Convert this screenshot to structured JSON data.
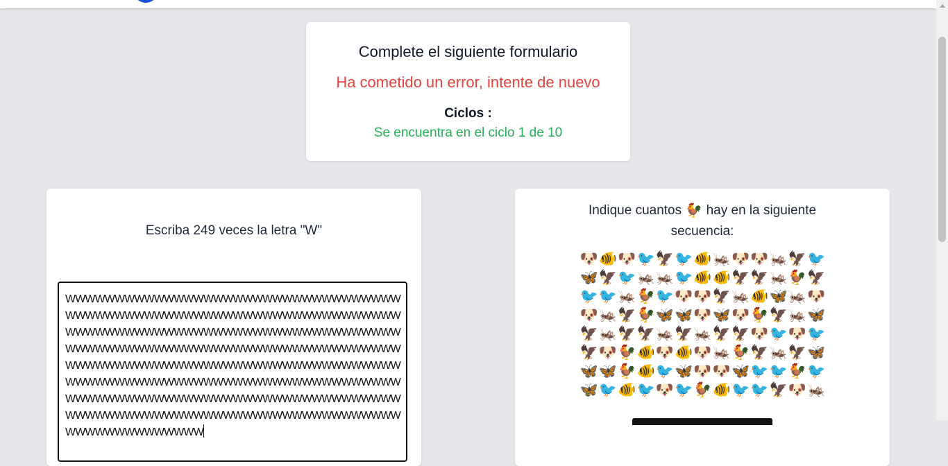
{
  "header": {
    "title": "Complete el siguiente formulario",
    "error_message": "Ha cometido un error, intente de nuevo",
    "cycles_label": "Ciclos :",
    "cycles_status": "Se encuentra en el ciclo 1 de 10",
    "colors": {
      "error": "#e3433c",
      "success": "#22b057"
    }
  },
  "left_task": {
    "instruction": "Escriba 249 veces la letra \"W\"",
    "answer_value": "WWWWWWWWWWWWWWWWWWWWWWWWWWWWWWWWWWWWWWWWWWWWWWWWWWWWWWWWWWWWWWWWWWWWWWWWWWWWWWWWWWWWWWWWWWWWWWWWWWWWWWWWWWWWWWWWWWWWWWWWWWWWWWWWWWWWWWWWWWWWWWWWWWWWWWWWWWWWWWWWWWWWWWWWWWWWWWWWWWWWWWWWWWWWWWWWWWWWWWWWWWWWWWWWWWWWWWWWWWWWWWWWWWWWWWWWWWWWWWWWWWWWWWWWWWWWWWWWWWWWWWWWWWWWWWWWWWWWWWWWWWWWWW"
  },
  "right_task": {
    "question_prefix": "Indique cuantos",
    "target_emoji": "🐓",
    "question_suffix": "hay en la siguiente secuencia:",
    "sequence_rows": [
      [
        "🐶",
        "🐠",
        "🐶",
        "🐦",
        "🦅",
        "🐦",
        "🐠",
        "🦗",
        "🐶",
        "🐶",
        "🦗",
        "🦅",
        "🐦"
      ],
      [
        "🦋",
        "🦅",
        "🐦",
        "🦗",
        "🦗",
        "🐦",
        "🐠",
        "🐠",
        "🦅",
        "🦅",
        "🦗",
        "🐓",
        "🦅"
      ],
      [
        "🐦",
        "🐦",
        "🦗",
        "🐓",
        "🐦",
        "🐶",
        "🐶",
        "🦅",
        "🦗",
        "🐠",
        "🦋",
        "🦗",
        "🐶"
      ],
      [
        "🐶",
        "🦗",
        "🦅",
        "🐓",
        "🦋",
        "🦋",
        "🐶",
        "🦋",
        "🐶",
        "🐓",
        "🦅",
        "🦗",
        "🦋"
      ],
      [
        "🦅",
        "🦗",
        "🦅",
        "🦅",
        "🦗",
        "🦅",
        "🦗",
        "🦅",
        "🦅",
        "🐶",
        "🐦",
        "🐶",
        "🐦"
      ],
      [
        "🦅",
        "🐶",
        "🐓",
        "🐠",
        "🐶",
        "🐠",
        "🐶",
        "🦗",
        "🐓",
        "🦅",
        "🦗",
        "🦅",
        "🦋"
      ],
      [
        "🦋",
        "🦋",
        "🐓",
        "🐠",
        "🐦",
        "🦋",
        "🐶",
        "🐶",
        "🦋",
        "🐦",
        "🐦",
        "🐓",
        "🐦"
      ],
      [
        "🦋",
        "🐦",
        "🐠",
        "🐦",
        "🐶",
        "🐦",
        "🐓",
        "🐠",
        "🐦",
        "🐦",
        "🦅",
        "🐶",
        "🦗"
      ]
    ]
  }
}
